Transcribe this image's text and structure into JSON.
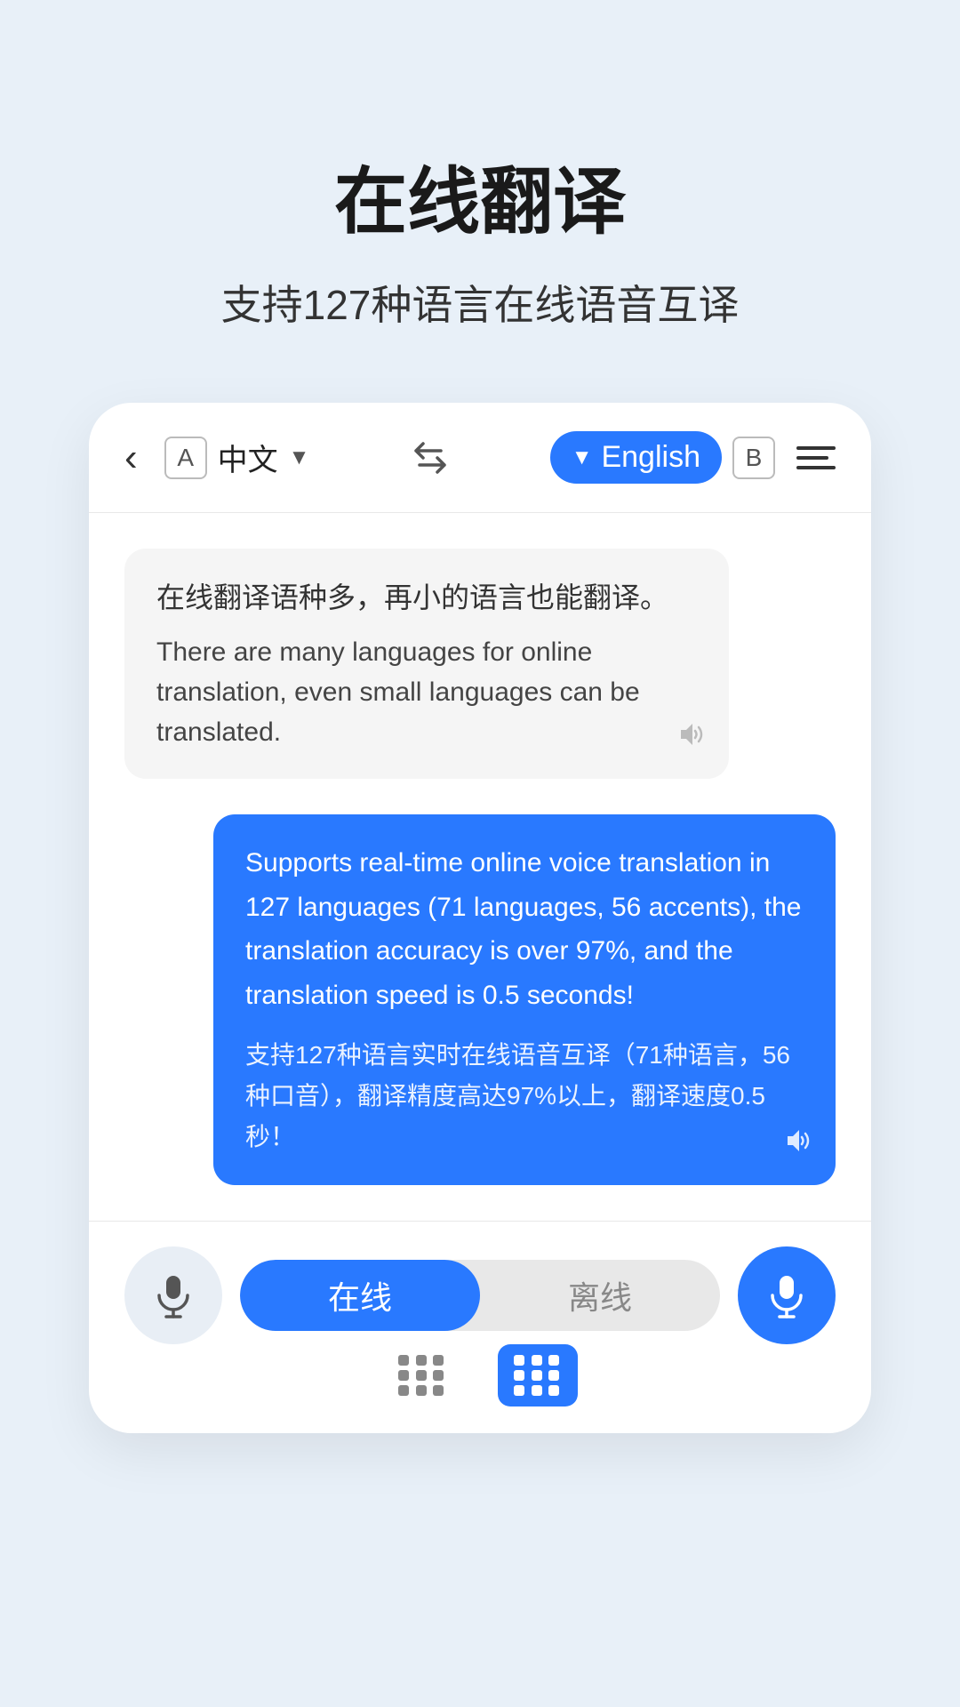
{
  "header": {
    "title": "在线翻译",
    "subtitle": "支持127种语言在线语音互译"
  },
  "topbar": {
    "lang_a_label": "A",
    "lang_chinese": "中文",
    "swap_icon": "⇌",
    "lang_english": "English",
    "lang_b_label": "B"
  },
  "chat": {
    "received": {
      "original": "在线翻译语种多，再小的语言也能翻译。",
      "translation": "There are many languages for online translation, even small languages can be translated."
    },
    "sent": {
      "english": "Supports real-time online voice translation in 127 languages (71 languages, 56 accents), the translation accuracy is over 97%, and the translation speed is 0.5 seconds!",
      "chinese": "支持127种语言实时在线语音互译（71种语言，56种口音），翻译精度高达97%以上，翻译速度0.5秒！"
    }
  },
  "bottom": {
    "online_label": "在线",
    "offline_label": "离线"
  }
}
